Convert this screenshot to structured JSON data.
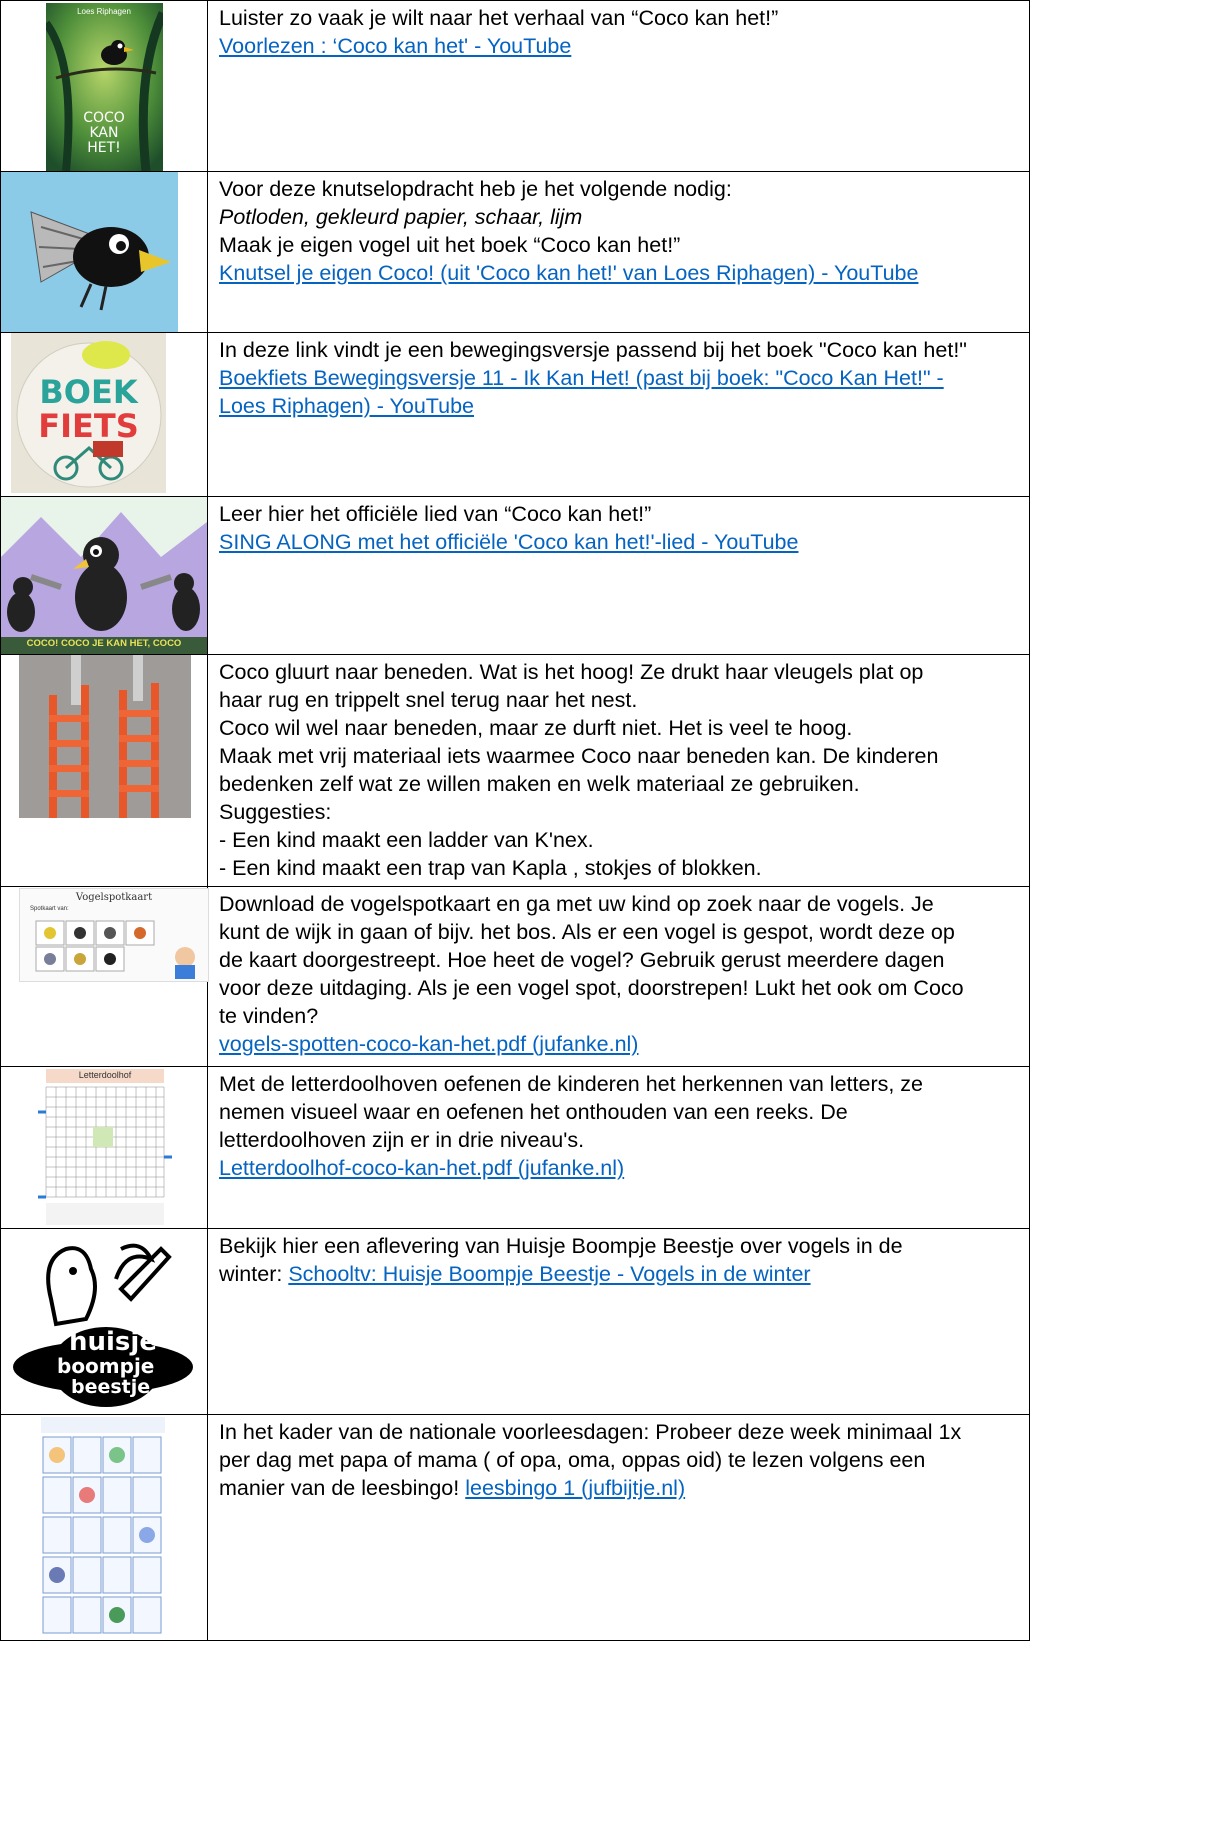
{
  "rows": [
    {
      "lines": [
        "Luister zo vaak je wilt naar het verhaal van “Coco kan het!”"
      ],
      "links": [
        "Voorlezen : ‘Coco kan het' - YouTube"
      ],
      "image": {
        "icon": "coco-book-cover-icon",
        "author": "Loes Riphagen",
        "title1": "COCO",
        "title2": "KAN",
        "title3": "HET!"
      }
    },
    {
      "lines": [
        "Voor deze knutselopdracht heb je het volgende nodig:",
        "Potloden, gekleurd papier, schaar, lijm",
        "Maak je eigen vogel uit het boek “Coco kan het!”"
      ],
      "links": [
        "Knutsel je eigen Coco! (uit 'Coco kan het!' van Loes Riphagen) - YouTube"
      ],
      "image": {
        "icon": "paper-bird-craft-icon"
      }
    },
    {
      "lines": [
        "In deze link vindt je een bewegingsversje passend bij het boek \"Coco kan het!\""
      ],
      "links": [
        "Boekfiets Bewegingsversje 11 - Ik Kan Het! (past bij boek: \"Coco Kan Het!\" -",
        "Loes Riphagen) - YouTube"
      ],
      "image": {
        "icon": "boekfiets-logo-icon",
        "word1": "BOEK",
        "word2": "FIETS"
      }
    },
    {
      "lines": [
        "Leer hier het officiële lied van “Coco kan het!”"
      ],
      "links": [
        "SING ALONG met het officiële 'Coco kan het!'-lied - YouTube"
      ],
      "image": {
        "icon": "sing-along-crows-icon",
        "caption": "COCO! COCO JE KAN HET, COCO"
      }
    },
    {
      "lines": [
        "Coco gluurt naar beneden. Wat is het hoog! Ze drukt haar vleugels plat op",
        "haar rug en trippelt snel terug naar het nest.",
        "Coco wil wel naar beneden, maar ze durft niet. Het is veel te hoog.",
        "Maak met vrij materiaal iets waarmee Coco naar beneden kan. De kinderen",
        "bedenken zelf wat ze willen maken en welk materiaal ze gebruiken.",
        "Suggesties:",
        "- Een kind maakt een ladder van K'nex.",
        "- Een kind maakt een trap van Kapla , stokjes of blokken."
      ],
      "links": [],
      "image": {
        "icon": "knex-ladder-photo-icon"
      }
    },
    {
      "lines": [
        "Download de vogelspotkaart en ga met uw kind op zoek naar de vogels. Je",
        "kunt de wijk in gaan of bijv. het bos. Als er een vogel is gespot, wordt deze op",
        "de kaart doorgestreept. Hoe heet de vogel? Gebruik gerust meerdere dagen",
        "voor deze uitdaging. Als je een vogel spot, doorstrepen! Lukt het ook om Coco",
        "te vinden?"
      ],
      "links": [
        "vogels-spotten-coco-kan-het.pdf (jufanke.nl)"
      ],
      "image": {
        "icon": "vogelspotkaart-icon",
        "title": "Vogelspotkaart",
        "sub": "Spotkaart van:"
      }
    },
    {
      "lines": [
        "Met de letterdoolhoven oefenen de kinderen het herkennen van letters, ze",
        "nemen visueel waar en oefenen het onthouden van een reeks. De",
        "letterdoolhoven zijn er in drie niveau's."
      ],
      "links": [
        "Letterdoolhof-coco-kan-het.pdf (jufanke.nl)"
      ],
      "image": {
        "icon": "letterdoolhof-icon",
        "title": "Letterdoolhof"
      }
    },
    {
      "lines": [
        "Bekijk hier een aflevering van Huisje Boompje Beestje over vogels in de"
      ],
      "tail": "winter: ",
      "tail_link": "Schooltv: Huisje Boompje Beestje - Vogels in de winter",
      "links": [],
      "image": {
        "icon": "huisje-boompje-beestje-logo-icon",
        "w1": "huisje",
        "w2": "boompje",
        "w3": "beestje"
      }
    },
    {
      "lines": [
        "In het kader van de nationale voorleesdagen: Probeer deze week minimaal 1x",
        "per dag met papa of mama ( of opa, oma, oppas oid) te lezen volgens een"
      ],
      "tail": "manier van de leesbingo! ",
      "tail_link": "leesbingo 1 (jufbijtje.nl)",
      "links": [],
      "image": {
        "icon": "leesbingo-sheet-icon"
      }
    }
  ],
  "colors": {
    "link": "#0563c1",
    "border": "#000000"
  }
}
